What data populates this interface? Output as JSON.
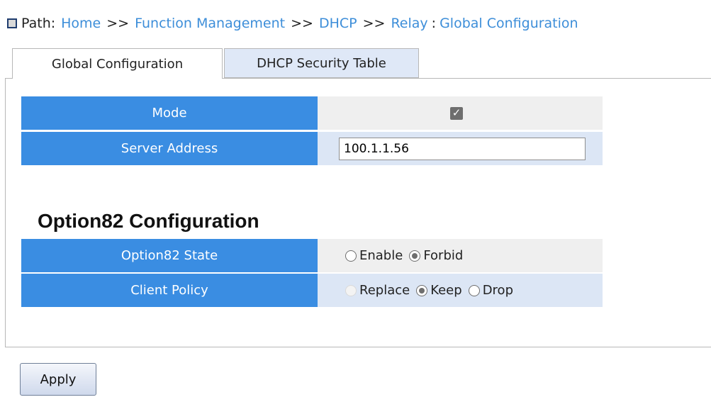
{
  "breadcrumb": {
    "label": "Path:",
    "items": [
      "Home",
      "Function Management",
      "DHCP",
      "Relay",
      "Global Configuration"
    ],
    "separator": ">>",
    "last_separator": ":"
  },
  "tabs": [
    {
      "label": "Global Configuration",
      "active": true
    },
    {
      "label": "DHCP Security Table",
      "active": false
    }
  ],
  "global": {
    "mode_label": "Mode",
    "mode_checked": true,
    "server_address_label": "Server Address",
    "server_address_value": "100.1.1.56"
  },
  "option82": {
    "title": "Option82 Configuration",
    "state_label": "Option82 State",
    "state_options": [
      "Enable",
      "Forbid"
    ],
    "state_selected": "Forbid",
    "policy_label": "Client Policy",
    "policy_options": [
      "Replace",
      "Keep",
      "Drop"
    ],
    "policy_selected": "Keep",
    "policy_disabled": [
      "Replace"
    ]
  },
  "buttons": {
    "apply_label": "Apply"
  },
  "colors": {
    "header_blue": "#3a8de2",
    "link_blue": "#3d8ed9",
    "tab_inactive": "#dfe8f7"
  }
}
